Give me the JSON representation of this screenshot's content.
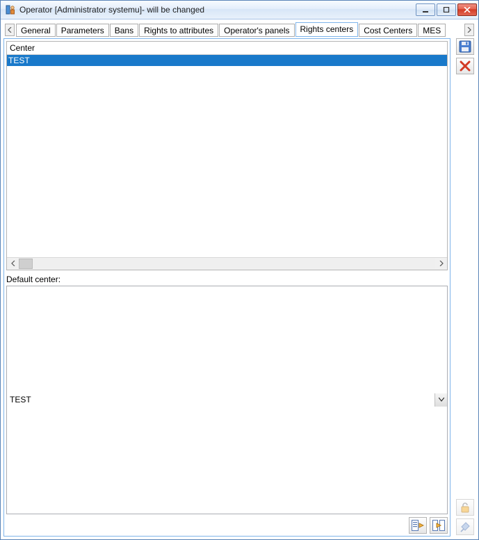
{
  "window": {
    "title": "Operator [Administrator systemu]- will be changed"
  },
  "tabs": {
    "items": [
      {
        "label": "General"
      },
      {
        "label": "Parameters"
      },
      {
        "label": "Bans"
      },
      {
        "label": "Rights to attributes"
      },
      {
        "label": "Operator's panels"
      },
      {
        "label": "Rights centers"
      },
      {
        "label": "Cost Centers"
      },
      {
        "label": "MES"
      }
    ],
    "active_index": 5
  },
  "grid": {
    "header": "Center",
    "rows": [
      {
        "value": "TEST",
        "selected": true
      }
    ]
  },
  "default_center": {
    "label": "Default center:",
    "value": "TEST"
  },
  "icons": {
    "save": "save-icon",
    "delete": "delete-icon",
    "unlock": "unlock-icon",
    "pin": "pin-icon",
    "addone": "add-from-list-icon",
    "addall": "add-all-icon"
  }
}
